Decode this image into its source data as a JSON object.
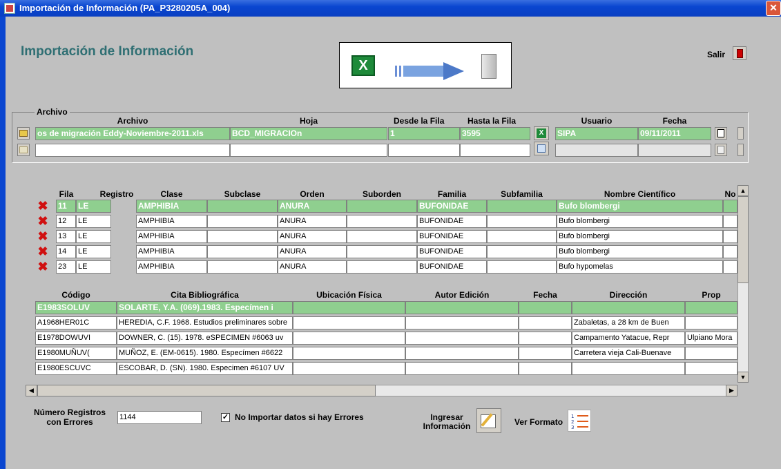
{
  "window": {
    "title": "Importación de Información  (PA_P3280205A_004)"
  },
  "header": {
    "heading": "Importación de Información",
    "exit_label": "Salir"
  },
  "archivo": {
    "group_label": "Archivo",
    "headers": {
      "archivo": "Archivo",
      "hoja": "Hoja",
      "desde": "Desde la Fila",
      "hasta": "Hasta la Fila",
      "usuario": "Usuario",
      "fecha": "Fecha"
    },
    "rows": [
      {
        "archivo": "os de migración Eddy-Noviembre-2011.xls",
        "hoja": "BCD_MIGRACIOn",
        "desde": "1",
        "hasta": "3595",
        "usuario": "SIPA",
        "fecha": "09/11/2011"
      },
      {
        "archivo": "",
        "hoja": "",
        "desde": "",
        "hasta": "",
        "usuario": "",
        "fecha": ""
      }
    ]
  },
  "grid1": {
    "headers": [
      "Fila",
      "Registro",
      "Clase",
      "Subclase",
      "Orden",
      "Suborden",
      "Familia",
      "Subfamilia",
      "Nombre Científico",
      "No"
    ],
    "rows": [
      [
        "11",
        "LE",
        "AMPHIBIA",
        "",
        "ANURA",
        "",
        "BUFONIDAE",
        "",
        "Bufo blombergi",
        ""
      ],
      [
        "12",
        "LE",
        "AMPHIBIA",
        "",
        "ANURA",
        "",
        "BUFONIDAE",
        "",
        "Bufo blombergi",
        ""
      ],
      [
        "13",
        "LE",
        "AMPHIBIA",
        "",
        "ANURA",
        "",
        "BUFONIDAE",
        "",
        "Bufo blombergi",
        ""
      ],
      [
        "14",
        "LE",
        "AMPHIBIA",
        "",
        "ANURA",
        "",
        "BUFONIDAE",
        "",
        "Bufo blombergi",
        ""
      ],
      [
        "23",
        "LE",
        "AMPHIBIA",
        "",
        "ANURA",
        "",
        "BUFONIDAE",
        "",
        "Bufo hypomelas",
        ""
      ]
    ]
  },
  "grid2": {
    "headers": [
      "Código",
      "Cita Bibliográfica",
      "Ubicación Física",
      "Autor Edición",
      "Fecha",
      "Dirección",
      "Prop"
    ],
    "rows": [
      [
        "E1983SOLUV",
        "SOLARTE, Y.A. (069).1983. Especímen i",
        "",
        "",
        "",
        "",
        ""
      ],
      [
        "A1968HER01C",
        "HEREDIA, C.F. 1968. Estudios preliminares sobre",
        "",
        "",
        "",
        "Zabaletas, a 28 km de Buen",
        ""
      ],
      [
        "E1978DOWUVI",
        "DOWNER, C. (15). 1978. eSPECIMEN #6063 uv",
        "",
        "",
        "",
        "Campamento Yatacue, Repr",
        "Ulpiano Mora"
      ],
      [
        "E1980MUÑUV(",
        "MUÑOZ, E. (EM-0615). 1980. Especímen #6622",
        "",
        "",
        "",
        "Carretera vieja Cali-Buenave",
        ""
      ],
      [
        "E1980ESCUVC",
        "ESCOBAR, D. (SN). 1980. Especimen #6107 UV",
        "",
        "",
        "",
        "",
        ""
      ]
    ]
  },
  "footer": {
    "errors_label_1": "Número Registros",
    "errors_label_2": "con Errores",
    "errors_value": "1144",
    "checkbox_label": "No Importar datos si hay Errores",
    "checkbox_checked": true,
    "ingresar_1": "Ingresar",
    "ingresar_2": "Información",
    "ver_formato": "Ver Formato"
  },
  "colors": {
    "selected_row": "#8fcf8f",
    "heading": "#2f6f73",
    "delete": "#d01010",
    "background": "#c0c0c0"
  },
  "icons": [
    "window-app-icon",
    "close-icon",
    "exit-door-icon",
    "excel-icon",
    "arrow-right-icon",
    "server-icon",
    "folder-open-icon",
    "excel-small-icon",
    "export-icon",
    "checklist-icon",
    "delete-icon",
    "edit-pencil-icon",
    "list-format-icon"
  ]
}
